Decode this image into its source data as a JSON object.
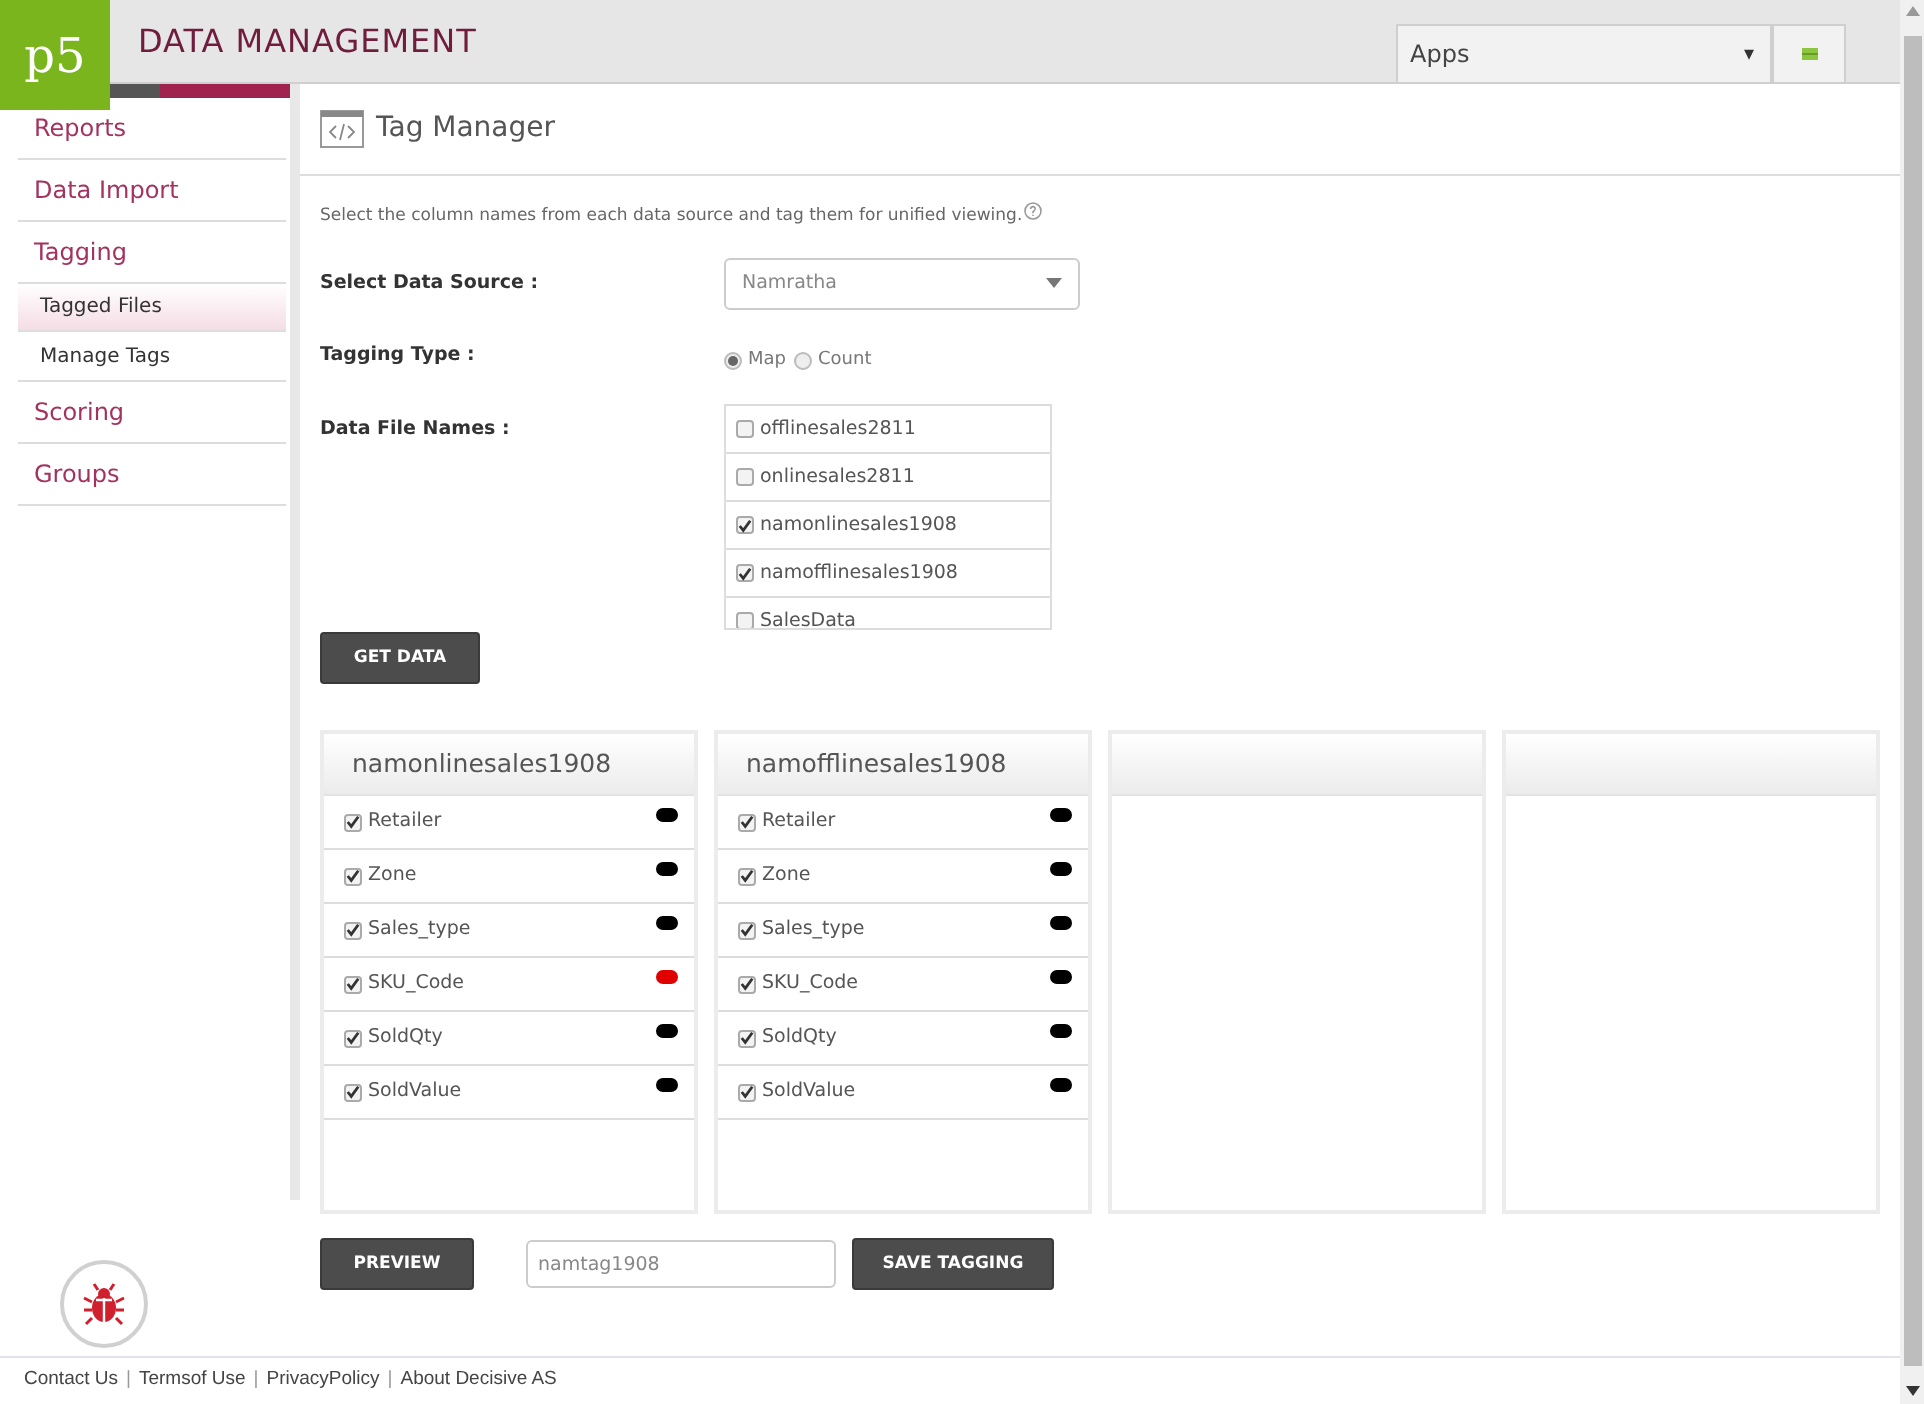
{
  "header": {
    "logo": "p5",
    "title": "DATA MANAGEMENT",
    "apps_select": "Apps",
    "apps_caret": "▾"
  },
  "sidebar": {
    "items": [
      {
        "label": "Reports",
        "selected": false
      },
      {
        "label": "Data Import",
        "selected": false
      },
      {
        "label": "Tagging",
        "selected": false,
        "children": [
          {
            "label": "Tagged Files",
            "selected": true
          },
          {
            "label": "Manage Tags",
            "selected": false
          }
        ]
      },
      {
        "label": "Scoring",
        "selected": false
      },
      {
        "label": "Groups",
        "selected": false
      }
    ]
  },
  "page": {
    "title": "Tag Manager",
    "description": "Select the column names from each data source and tag them for unified viewing.",
    "data_source": {
      "label": "Select Data Source :",
      "value": "Namratha"
    },
    "tagging_type": {
      "label": "Tagging Type :",
      "options": [
        {
          "label": "Map",
          "selected": true
        },
        {
          "label": "Count",
          "selected": false
        }
      ]
    },
    "data_files": {
      "label": "Data File Names :",
      "files": [
        {
          "name": "offlinesales2811",
          "checked": false
        },
        {
          "name": "onlinesales2811",
          "checked": false
        },
        {
          "name": "namonlinesales1908",
          "checked": true
        },
        {
          "name": "namofflinesales1908",
          "checked": true
        },
        {
          "name": "SalesData",
          "checked": false
        }
      ]
    },
    "get_data_button": "GET DATA",
    "panels": [
      {
        "kind": "filled",
        "title": "namonlinesales1908",
        "fields": [
          {
            "name": "Retailer",
            "checked": true,
            "color": "#000000"
          },
          {
            "name": "Zone",
            "checked": true,
            "color": "#000000"
          },
          {
            "name": "Sales_type",
            "checked": true,
            "color": "#000000"
          },
          {
            "name": "SKU_Code",
            "checked": true,
            "color": "#e00000"
          },
          {
            "name": "SoldQty",
            "checked": true,
            "color": "#000000"
          },
          {
            "name": "SoldValue",
            "checked": true,
            "color": "#000000"
          }
        ]
      },
      {
        "kind": "filled",
        "title": "namofflinesales1908",
        "fields": [
          {
            "name": "Retailer",
            "checked": true,
            "color": "#000000"
          },
          {
            "name": "Zone",
            "checked": true,
            "color": "#000000"
          },
          {
            "name": "Sales_type",
            "checked": true,
            "color": "#000000"
          },
          {
            "name": "SKU_Code",
            "checked": true,
            "color": "#000000"
          },
          {
            "name": "SoldQty",
            "checked": true,
            "color": "#000000"
          },
          {
            "name": "SoldValue",
            "checked": true,
            "color": "#000000"
          }
        ]
      },
      {
        "kind": "empty"
      },
      {
        "kind": "empty"
      }
    ],
    "preview_button": "PREVIEW",
    "tag_name": "namtag1908",
    "save_button": "SAVE TAGGING"
  },
  "footer": {
    "links": [
      "Contact Us",
      "Termsof Use",
      "PrivacyPolicy",
      "About Decisive AS"
    ],
    "separator": "|"
  }
}
